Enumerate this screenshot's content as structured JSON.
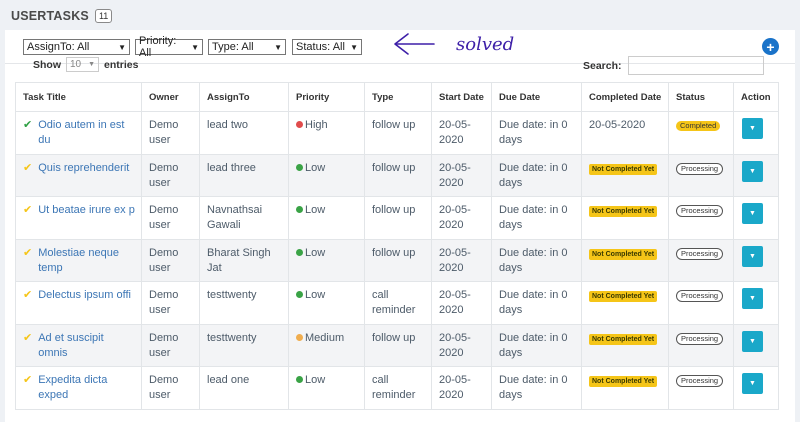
{
  "page": {
    "title": "USERTASKS",
    "count": "11"
  },
  "filters": [
    {
      "label": "AssignTo: All"
    },
    {
      "label": "Priority: All"
    },
    {
      "label": "Type: All"
    },
    {
      "label": "Status: All"
    }
  ],
  "annotation": {
    "text": "solved"
  },
  "add_button": {
    "symbol": "+"
  },
  "length": {
    "show_label": "Show",
    "value": "10",
    "entries_label": "entries"
  },
  "search": {
    "label": "Search:",
    "value": ""
  },
  "columns": [
    "Task Title",
    "Owner",
    "AssignTo",
    "Priority",
    "Type",
    "Start Date",
    "Due Date",
    "Completed Date",
    "Status",
    "Action"
  ],
  "rows": [
    {
      "done": true,
      "title": "Odio autem in est du",
      "owner": "Demo user",
      "assign": "lead two",
      "priority": "High",
      "priority_color": "#e04c4c",
      "type": "follow up",
      "start": "20-05-2020",
      "due": "Due date: in 0 days",
      "completed": "20-05-2020",
      "status": "Completed"
    },
    {
      "done": false,
      "title": "Quis reprehenderit",
      "owner": "Demo user",
      "assign": "lead three",
      "priority": "Low",
      "priority_color": "#3aa346",
      "type": "follow up",
      "start": "20-05-2020",
      "due": "Due date: in 0 days",
      "completed": "Not Completed Yet",
      "status": "Processing"
    },
    {
      "done": false,
      "title": "Ut beatae irure ex p",
      "owner": "Demo user",
      "assign": "Navnathsai Gawali",
      "priority": "Low",
      "priority_color": "#3aa346",
      "type": "follow up",
      "start": "20-05-2020",
      "due": "Due date: in 0 days",
      "completed": "Not Completed Yet",
      "status": "Processing"
    },
    {
      "done": false,
      "title": "Molestiae neque temp",
      "owner": "Demo user",
      "assign": "Bharat Singh Jat",
      "priority": "Low",
      "priority_color": "#3aa346",
      "type": "follow up",
      "start": "20-05-2020",
      "due": "Due date: in 0 days",
      "completed": "Not Completed Yet",
      "status": "Processing"
    },
    {
      "done": false,
      "title": "Delectus ipsum offi",
      "owner": "Demo user",
      "assign": "testtwenty",
      "priority": "Low",
      "priority_color": "#3aa346",
      "type": "call reminder",
      "start": "20-05-2020",
      "due": "Due date: in 0 days",
      "completed": "Not Completed Yet",
      "status": "Processing"
    },
    {
      "done": false,
      "title": "Ad et suscipit omnis",
      "owner": "Demo user",
      "assign": "testtwenty",
      "priority": "Medium",
      "priority_color": "#f0ad4e",
      "type": "follow up",
      "start": "20-05-2020",
      "due": "Due date: in 0 days",
      "completed": "Not Completed Yet",
      "status": "Processing"
    },
    {
      "done": false,
      "title": "Expedita dicta exped",
      "owner": "Demo user",
      "assign": "lead one",
      "priority": "Low",
      "priority_color": "#3aa346",
      "type": "call reminder",
      "start": "20-05-2020",
      "due": "Due date: in 0 days",
      "completed": "Not Completed Yet",
      "status": "Processing"
    }
  ],
  "icons": {
    "done": "check-icon",
    "pending": "check-icon",
    "action": "caret-down-icon",
    "add": "plus-circle-icon",
    "select": "caret-down-icon"
  },
  "colors": {
    "accent": "#1a73c9",
    "action": "#1aa8c9",
    "link": "#3c76b5",
    "warning": "#f5c518",
    "annotation": "#3d1fa8"
  }
}
